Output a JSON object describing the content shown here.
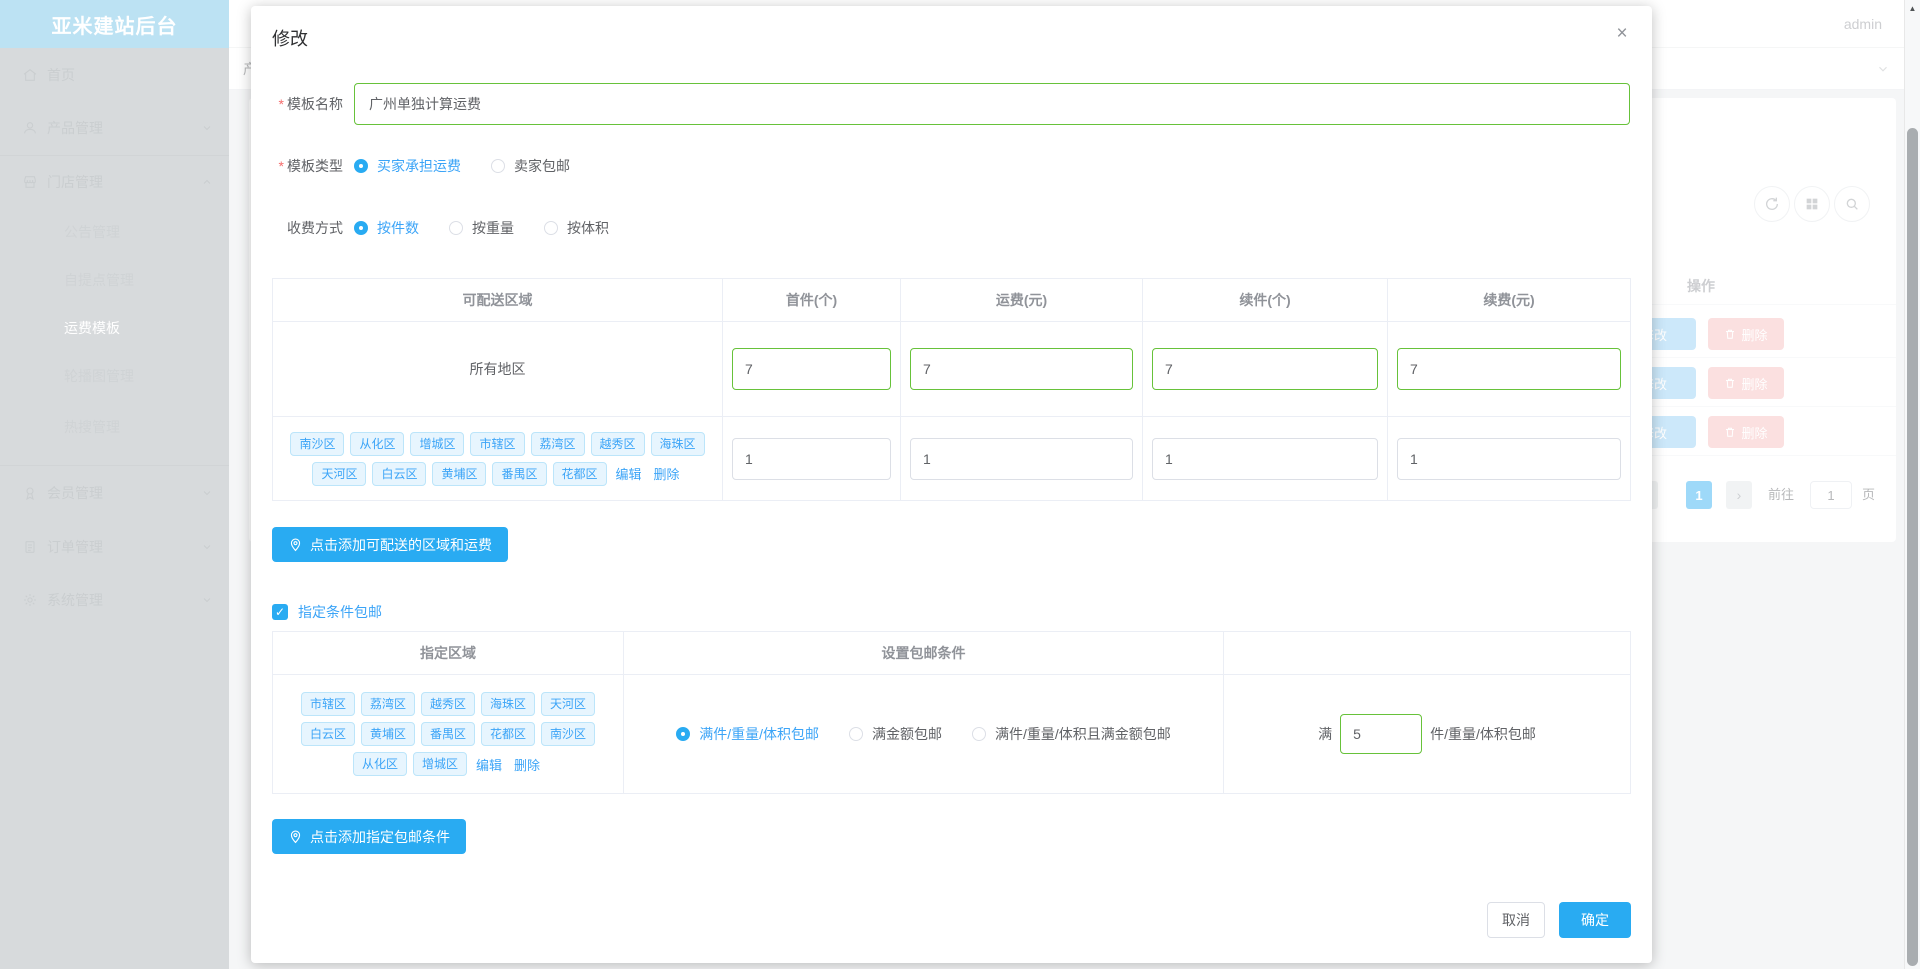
{
  "app": {
    "brand": "亚米建站后台",
    "user": "admin"
  },
  "topbar": {
    "breadcrumb": "产品管理"
  },
  "sidebar": {
    "items": [
      {
        "label": "首页",
        "icon": "home-icon"
      },
      {
        "label": "产品管理",
        "icon": "products-icon"
      },
      {
        "label": "门店管理",
        "icon": "store-icon",
        "expanded": true,
        "children": [
          {
            "label": "公告管理"
          },
          {
            "label": "自提点管理"
          },
          {
            "label": "运费模板",
            "active": true
          },
          {
            "label": "轮播图管理"
          },
          {
            "label": "热搜管理"
          }
        ]
      },
      {
        "label": "会员管理",
        "icon": "members-icon"
      },
      {
        "label": "订单管理",
        "icon": "orders-icon"
      },
      {
        "label": "系统管理",
        "icon": "system-icon"
      }
    ]
  },
  "list_page": {
    "ops_header": "操作",
    "edit_button": "修改",
    "delete_button": "删除",
    "pagination": {
      "prev": "‹",
      "next": "›",
      "current_page": "1",
      "goto_label": "前往",
      "goto_value": "1",
      "unit_label": "页"
    }
  },
  "dialog": {
    "title": "修改",
    "close": "×",
    "name_field": {
      "label": "模板名称",
      "value": "广州单独计算运费"
    },
    "type_field": {
      "label": "模板类型",
      "options": [
        "买家承担运费",
        "卖家包邮"
      ],
      "selected": "买家承担运费"
    },
    "charge_field": {
      "label": "收费方式",
      "options": [
        "按件数",
        "按重量",
        "按体积"
      ],
      "selected": "按件数"
    },
    "region_table": {
      "headers": [
        "可配送区域",
        "首件(个)",
        "运费(元)",
        "续件(个)",
        "续费(元)"
      ],
      "rows": [
        {
          "region": "所有地区",
          "values": [
            "7",
            "7",
            "7",
            "7"
          ]
        },
        {
          "tags": [
            "南沙区",
            "从化区",
            "增城区",
            "市辖区",
            "荔湾区",
            "越秀区",
            "海珠区",
            "天河区",
            "白云区",
            "黄埔区",
            "番禺区",
            "花都区"
          ],
          "edit_link": "编辑",
          "delete_link": "删除",
          "values": [
            "1",
            "1",
            "1",
            "1"
          ]
        }
      ]
    },
    "add_region_button": "点击添加可配送的区域和运费",
    "free_ship": {
      "checkbox_label": "指定条件包邮",
      "checked": true,
      "check_glyph": "✓",
      "headers": [
        "指定区域",
        "设置包邮条件",
        ""
      ],
      "tags": [
        "市辖区",
        "荔湾区",
        "越秀区",
        "海珠区",
        "天河区",
        "白云区",
        "黄埔区",
        "番禺区",
        "花都区",
        "南沙区",
        "从化区",
        "增城区"
      ],
      "edit_link": "编辑",
      "delete_link": "删除",
      "options": [
        "满件/重量/体积包邮",
        "满金额包邮",
        "满件/重量/体积且满金额包邮"
      ],
      "selected": "满件/重量/体积包邮",
      "threshold_prefix": "满",
      "threshold_value": "5",
      "threshold_suffix": "件/重量/体积包邮"
    },
    "add_condition_button": "点击添加指定包邮条件",
    "footer": {
      "cancel": "取消",
      "confirm": "确定"
    }
  },
  "colors": {
    "accent": "#29abf2",
    "link_blue": "#3ba4f7",
    "success_green": "#67c23a",
    "danger_red": "#f56c6c",
    "sidebar_header": "#6bbfe5"
  }
}
